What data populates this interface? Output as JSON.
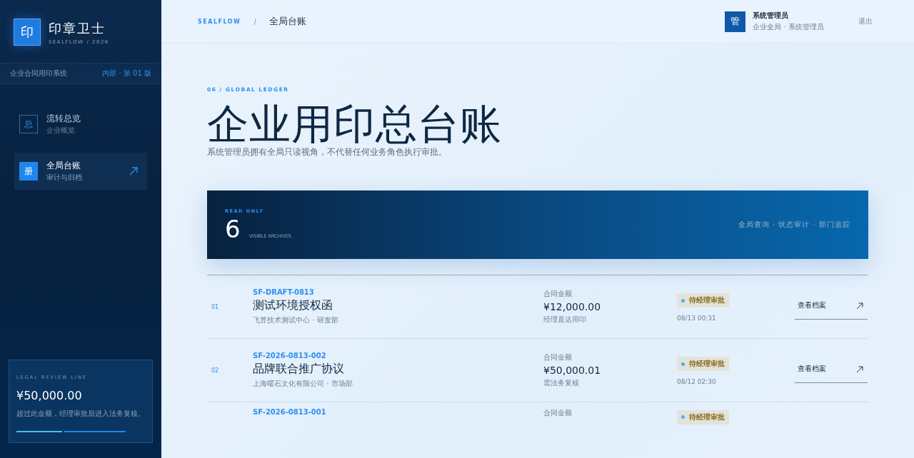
{
  "sidebar": {
    "logo_mark": "印",
    "brand": "印章卫士",
    "brand_sub": "SEALFLOW / 2026",
    "system": "企业合同用印系统",
    "edition": "内部 · 第 01 版",
    "nav": [
      {
        "mark": "总",
        "label": "流转总览",
        "sub": "企业概览",
        "selected": false
      },
      {
        "mark": "册",
        "label": "全局台账",
        "sub": "审计与归档",
        "selected": true
      }
    ],
    "review": {
      "eyebrow": "LEGAL REVIEW LINE",
      "amount": "¥50,000.00",
      "note": "超过此金额，经理审批后进入法务复核。"
    }
  },
  "header": {
    "brand": "SEALFLOW",
    "separator": "/",
    "page": "全局台账",
    "avatar": "管",
    "user": "系统管理员",
    "role": "企业全局 · 系统管理员",
    "logout": "退出"
  },
  "hero": {
    "eyebrow": "06 / GLOBAL LEDGER",
    "title": "企业用印总台账",
    "subtitle": "系统管理员拥有全局只读视角，不代替任何业务角色执行审批。"
  },
  "banner": {
    "eyebrow": "READ ONLY",
    "count": "6",
    "count_label": "VISIBLE ARCHIVES",
    "scope": "全局查询 · 状态审计 · 部门追踪"
  },
  "rows": [
    {
      "index": "01",
      "code": "SF-DRAFT-0813",
      "title": "测试环境授权函",
      "org": "飞算技术测试中心 · 研发部",
      "amount_label": "合同金额",
      "amount": "¥12,000.00",
      "route": "经理直达用印",
      "status": "待经理审批",
      "time": "08/13 00:31",
      "action": "查看档案"
    },
    {
      "index": "02",
      "code": "SF-2026-0813-002",
      "title": "品牌联合推广协议",
      "org": "上海曜石文化有限公司 · 市场部",
      "amount_label": "合同金额",
      "amount": "¥50,000.01",
      "route": "需法务复核",
      "status": "待经理审批",
      "time": "08/12 02:30",
      "action": "查看档案"
    },
    {
      "code": "SF-2026-0813-001",
      "amount_label": "合同金额",
      "status": "待经理审批"
    }
  ]
}
